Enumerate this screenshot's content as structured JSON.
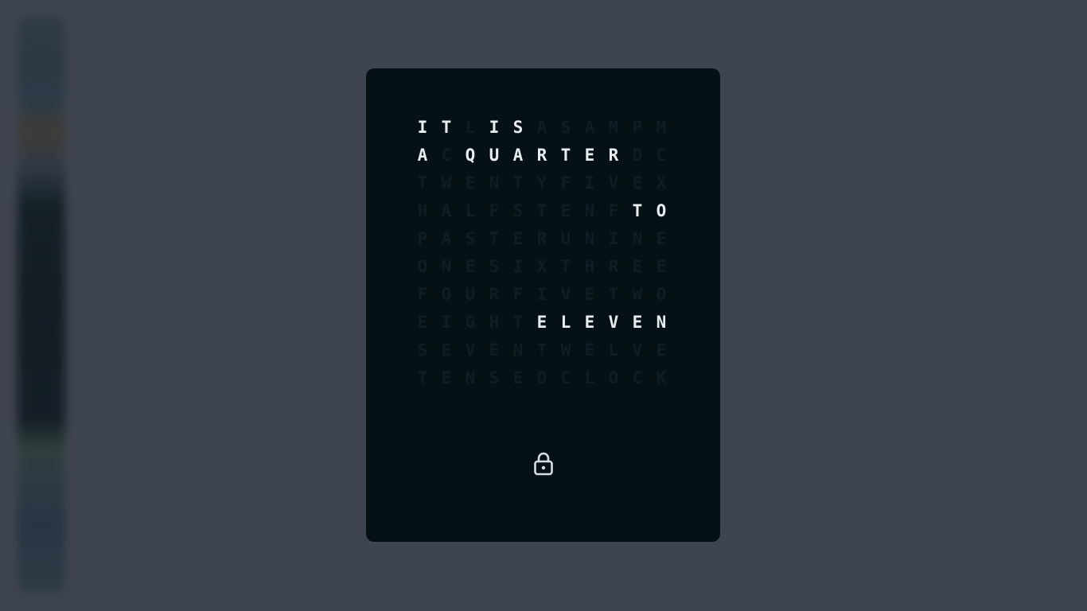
{
  "clock": {
    "grid_rows": [
      "ITLISASAMPM",
      "ACQUARTERDC",
      "TWENTYFIVEX",
      "HALFSTENFTO",
      "PASTERUNINE",
      "ONESIXTHREE",
      "FOURFIVETWO",
      "EIGHTELEVEN",
      "SEVENTWELVE",
      "TENSEOCLOCK"
    ],
    "lit_cells": [
      [
        0,
        0
      ],
      [
        0,
        1
      ],
      [
        0,
        3
      ],
      [
        0,
        4
      ],
      [
        1,
        0
      ],
      [
        1,
        2
      ],
      [
        1,
        3
      ],
      [
        1,
        4
      ],
      [
        1,
        5
      ],
      [
        1,
        6
      ],
      [
        1,
        7
      ],
      [
        1,
        8
      ],
      [
        3,
        9
      ],
      [
        3,
        10
      ],
      [
        7,
        5
      ],
      [
        7,
        6
      ],
      [
        7,
        7
      ],
      [
        7,
        8
      ],
      [
        7,
        9
      ],
      [
        7,
        10
      ]
    ],
    "displayed_phrase": "IT IS A QUARTER TO ELEVEN",
    "lit_color": "#e9edf0",
    "dim_color": "#0f1d24",
    "background_color": "#061116"
  },
  "lock": {
    "icon": "lock-icon"
  }
}
